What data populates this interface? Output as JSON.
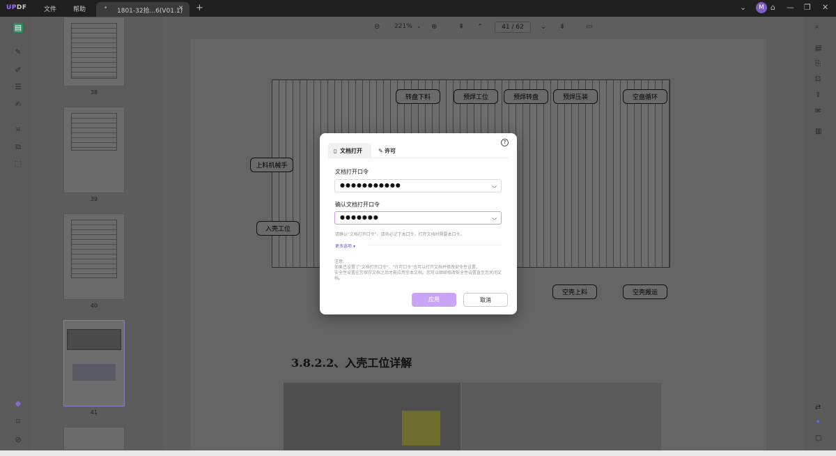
{
  "app": {
    "logo": "UPDF",
    "menu": [
      "文件",
      "帮助"
    ],
    "tab_title": "1801-32拾...6(V01.1)",
    "avatar_letter": "M"
  },
  "toolbar": {
    "zoom": "221%",
    "page_current": "41",
    "page_total": "62",
    "page_display": "41 / 62"
  },
  "thumbnails": [
    {
      "label": "38"
    },
    {
      "label": "39"
    },
    {
      "label": "40"
    },
    {
      "label": "41"
    }
  ],
  "document": {
    "callouts": [
      "转盘下料",
      "预焊工位",
      "预焊转盘",
      "预焊压装",
      "空盘循环",
      "上料机械手",
      "入壳工位",
      "空壳上料",
      "空壳搬运"
    ],
    "heading": "3.8.2.2、入壳工位详解"
  },
  "dialog": {
    "tab_open": "文档打开",
    "tab_permission": "许可",
    "help_glyph": "?",
    "label_password": "文档打开口令",
    "password_value": "●●●●●●●●●●●",
    "label_confirm": "确认文档打开口令",
    "confirm_value": "●●●●●●●",
    "hint": "请确认\"文档打开口令\"，请务必记下本口令，打开文档时需要本口令。",
    "more_options": "更多选项",
    "note_title": "注意:",
    "note_line1": "如果已设置了\"文档打开口令\"，\"许可口令\"也可以打开文档并修改安全性设置。",
    "note_line2": "安全性设置在您保存文档之后才能应用至本文档。您可以继续修改安全性设置直至您关闭文档。",
    "apply": "应用",
    "cancel": "取消",
    "accent": "#c9a6f5"
  }
}
